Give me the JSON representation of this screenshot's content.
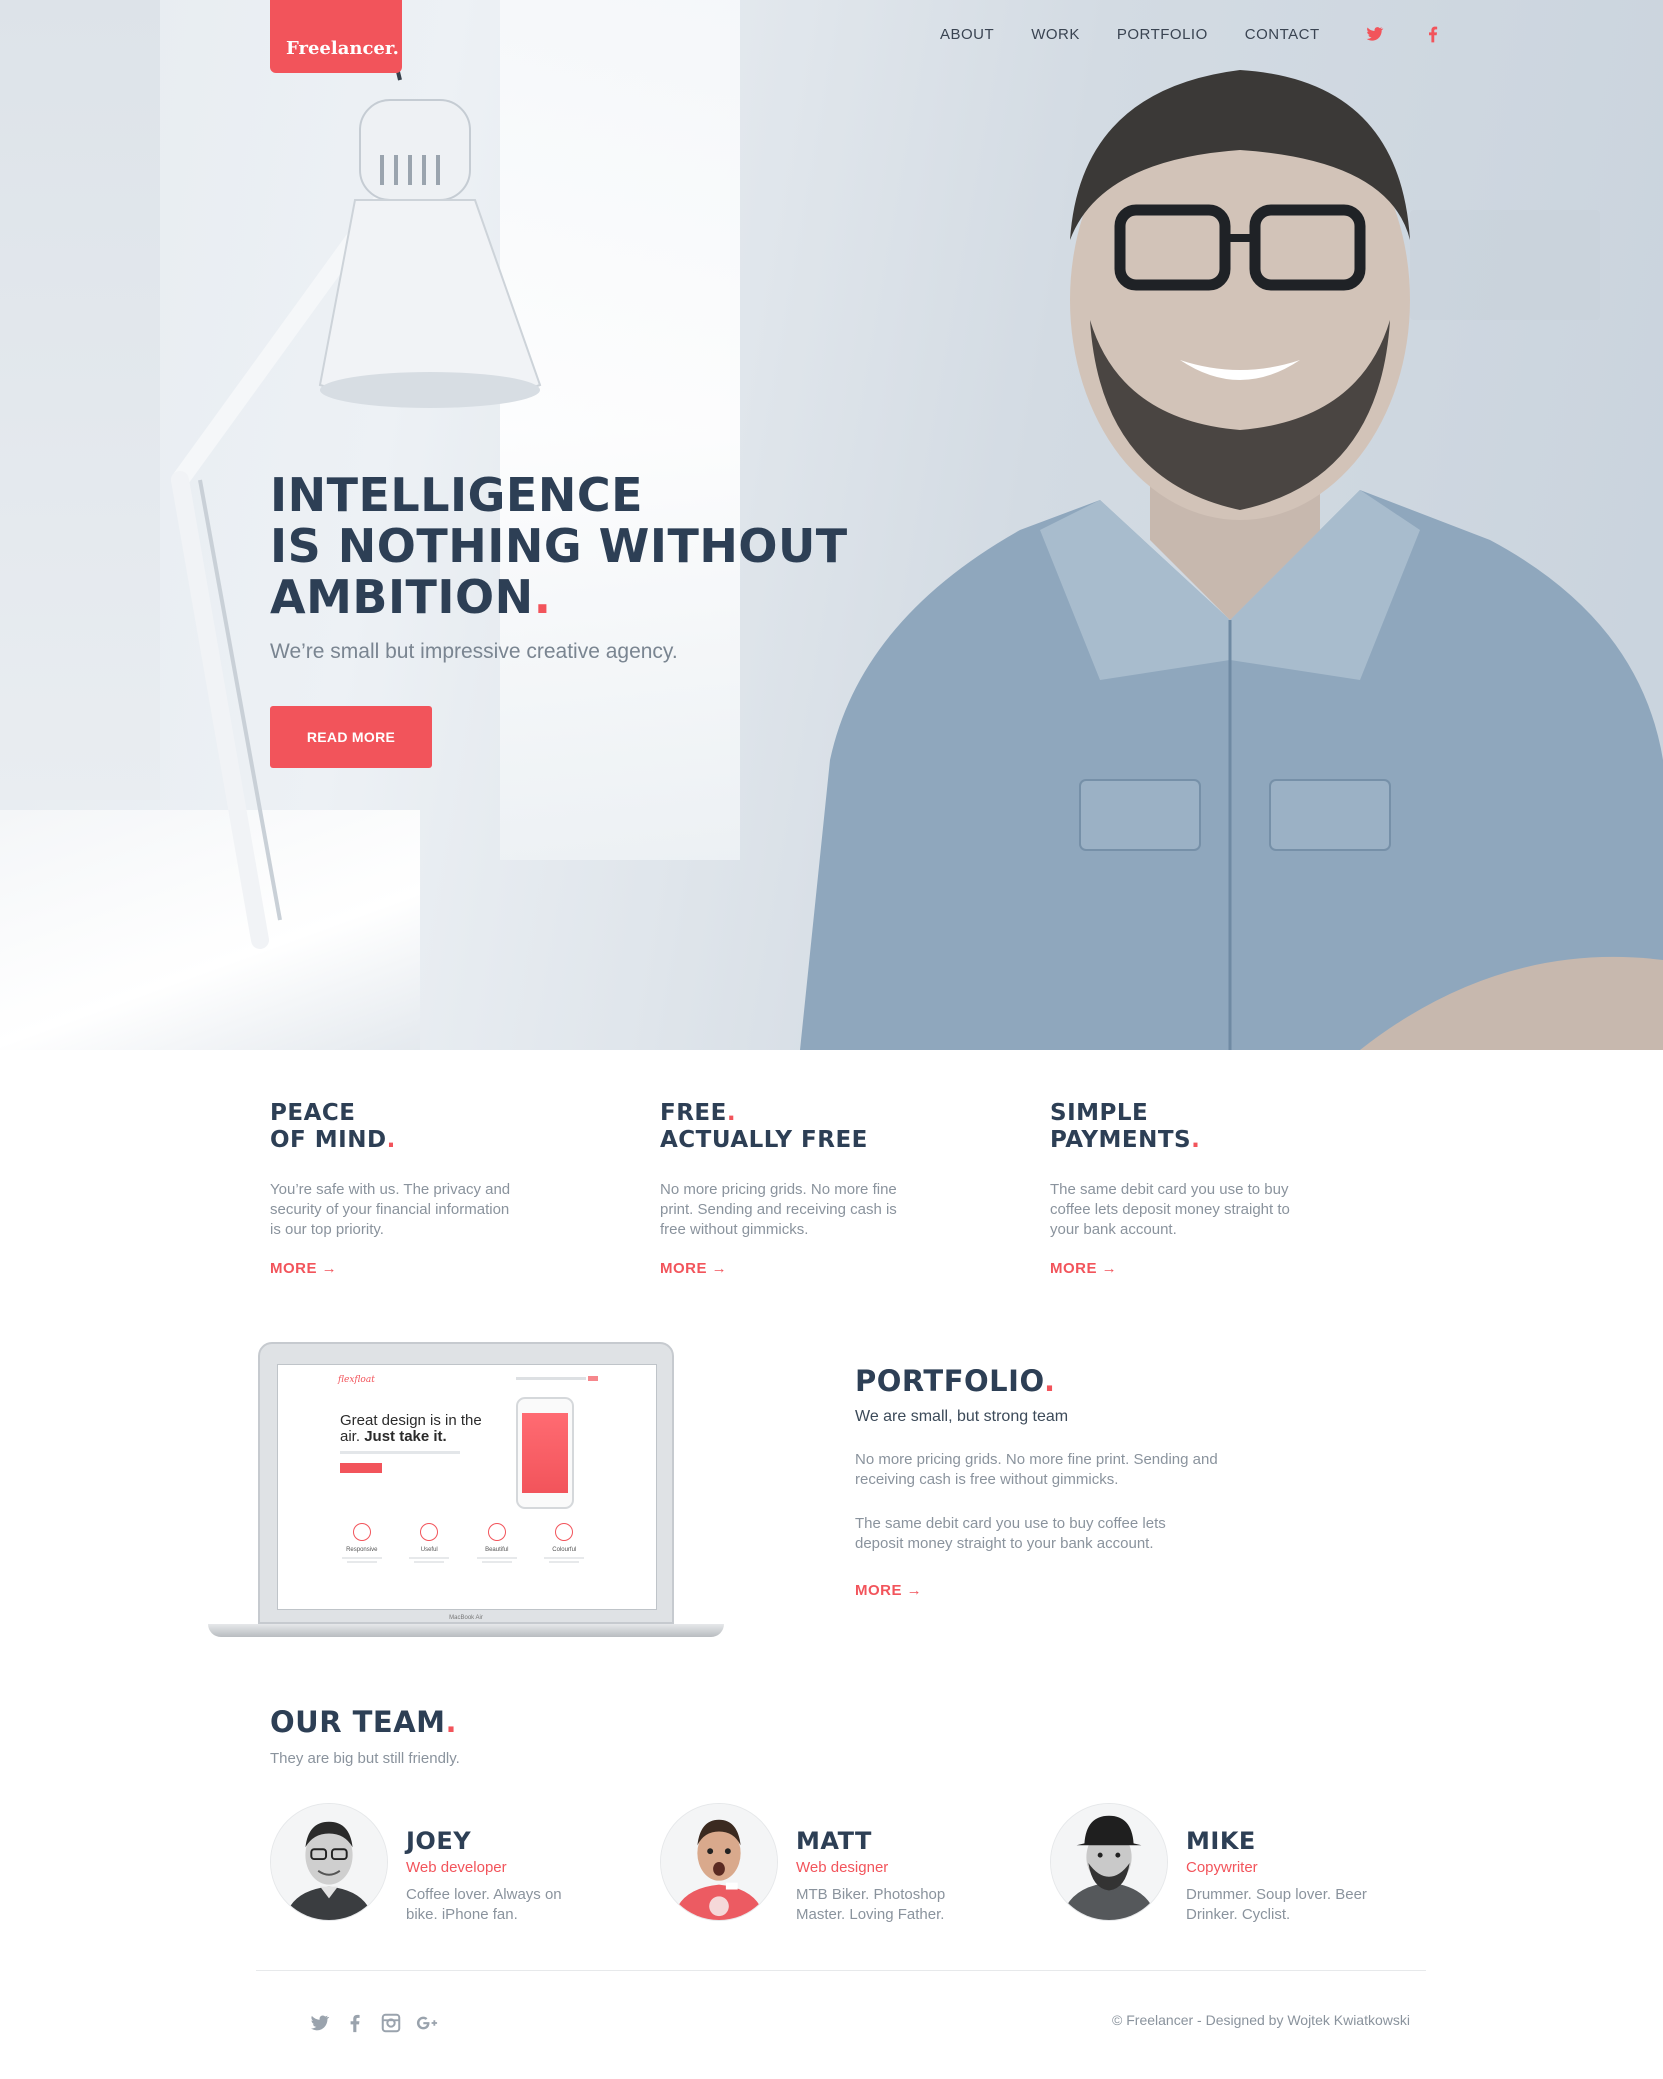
{
  "brand": {
    "logo": "Freelancer."
  },
  "nav": {
    "items": [
      "ABOUT",
      "WORK",
      "PORTFOLIO",
      "CONTACT"
    ],
    "social": [
      "twitter-icon",
      "facebook-icon"
    ]
  },
  "hero": {
    "headline_l1": "INTELLIGENCE",
    "headline_l2": "IS NOTHING WITHOUT",
    "headline_l3": "AMBITION",
    "dot": ".",
    "subtitle": "We’re small but impressive creative agency.",
    "cta": "READ MORE"
  },
  "features": [
    {
      "title_l1": "PEACE",
      "title_l2": "OF MIND",
      "title_l1_dot": "",
      "title_l2_dot": ".",
      "text": "You’re safe with us. The privacy and security of your financial information is our top priority.",
      "more": "MORE →"
    },
    {
      "title_l1": "FREE",
      "title_l2": "ACTUALLY FREE",
      "title_l1_dot": ".",
      "title_l2_dot": "",
      "text": "No more pricing grids. No more fine print. Sending and receiving cash is free without gimmicks.",
      "more": "MORE →"
    },
    {
      "title_l1": "SIMPLE",
      "title_l2": "PAYMENTS",
      "title_l1_dot": "",
      "title_l2_dot": ".",
      "text": "The same debit card you use to buy coffee lets deposit money straight to your bank account.",
      "more": "MORE →"
    }
  ],
  "portfolio": {
    "title": "PORTFOLIO",
    "subtitle": "We are small, but strong team",
    "p1": "No more pricing grids. No more fine print. Sending and receiving cash is free without gimmicks.",
    "p2": "The same debit card you use to buy coffee lets deposit money straight to your bank account.",
    "more": "MORE →",
    "screen": {
      "logo": "flexfloat",
      "headline_a": "Great design is in the air. ",
      "headline_b": "Just take it.",
      "icons": [
        "Responsive",
        "Useful",
        "Beautiful",
        "Colourful"
      ],
      "device_label": "MacBook Air"
    }
  },
  "team": {
    "title": "OUR TEAM",
    "subtitle": "They are big but still friendly.",
    "members": [
      {
        "name": "JOEY",
        "role": "Web developer",
        "bio": "Coffee lover. Always on bike. iPhone fan."
      },
      {
        "name": "MATT",
        "role": "Web designer",
        "bio": "MTB Biker. Photoshop Master. Loving Father."
      },
      {
        "name": "MIKE",
        "role": "Copywriter",
        "bio": "Drummer. Soup lover. Beer Drinker. Cyclist."
      }
    ]
  },
  "footer": {
    "social": [
      "twitter-icon",
      "facebook-icon",
      "instagram-icon",
      "google-plus-icon"
    ],
    "copyright": "© Freelancer - Designed by Wojtek Kwiatkowski"
  },
  "colors": {
    "accent": "#f2545b",
    "heading": "#2d3f55",
    "muted": "#8a939d"
  }
}
